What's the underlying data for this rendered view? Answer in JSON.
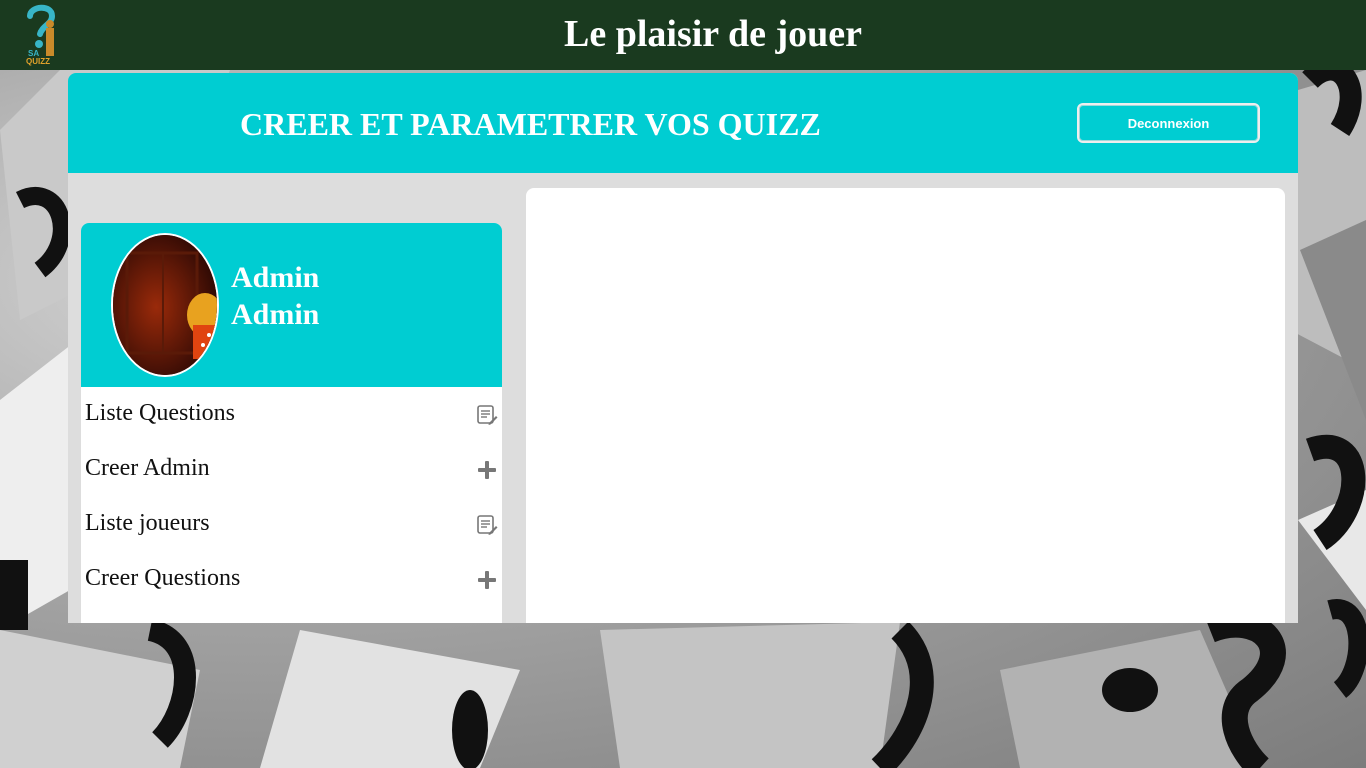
{
  "header": {
    "logo_text": "SA QUIZZ",
    "title": "Le plaisir de jouer"
  },
  "card": {
    "title": "CREER ET PARAMETRER VOS QUIZZ",
    "logout_label": "Deconnexion"
  },
  "profile": {
    "first_name": "Admin",
    "last_name": "Admin"
  },
  "menu": {
    "items": [
      {
        "label": "Liste Questions",
        "icon": "list-edit-icon"
      },
      {
        "label": "Creer Admin",
        "icon": "plus-icon"
      },
      {
        "label": "Liste joueurs",
        "icon": "list-edit-icon"
      },
      {
        "label": "Creer Questions",
        "icon": "plus-icon"
      }
    ]
  },
  "colors": {
    "topbar": "#1a3a1f",
    "accent": "#00cdd2",
    "card_bg": "#dddddd"
  }
}
